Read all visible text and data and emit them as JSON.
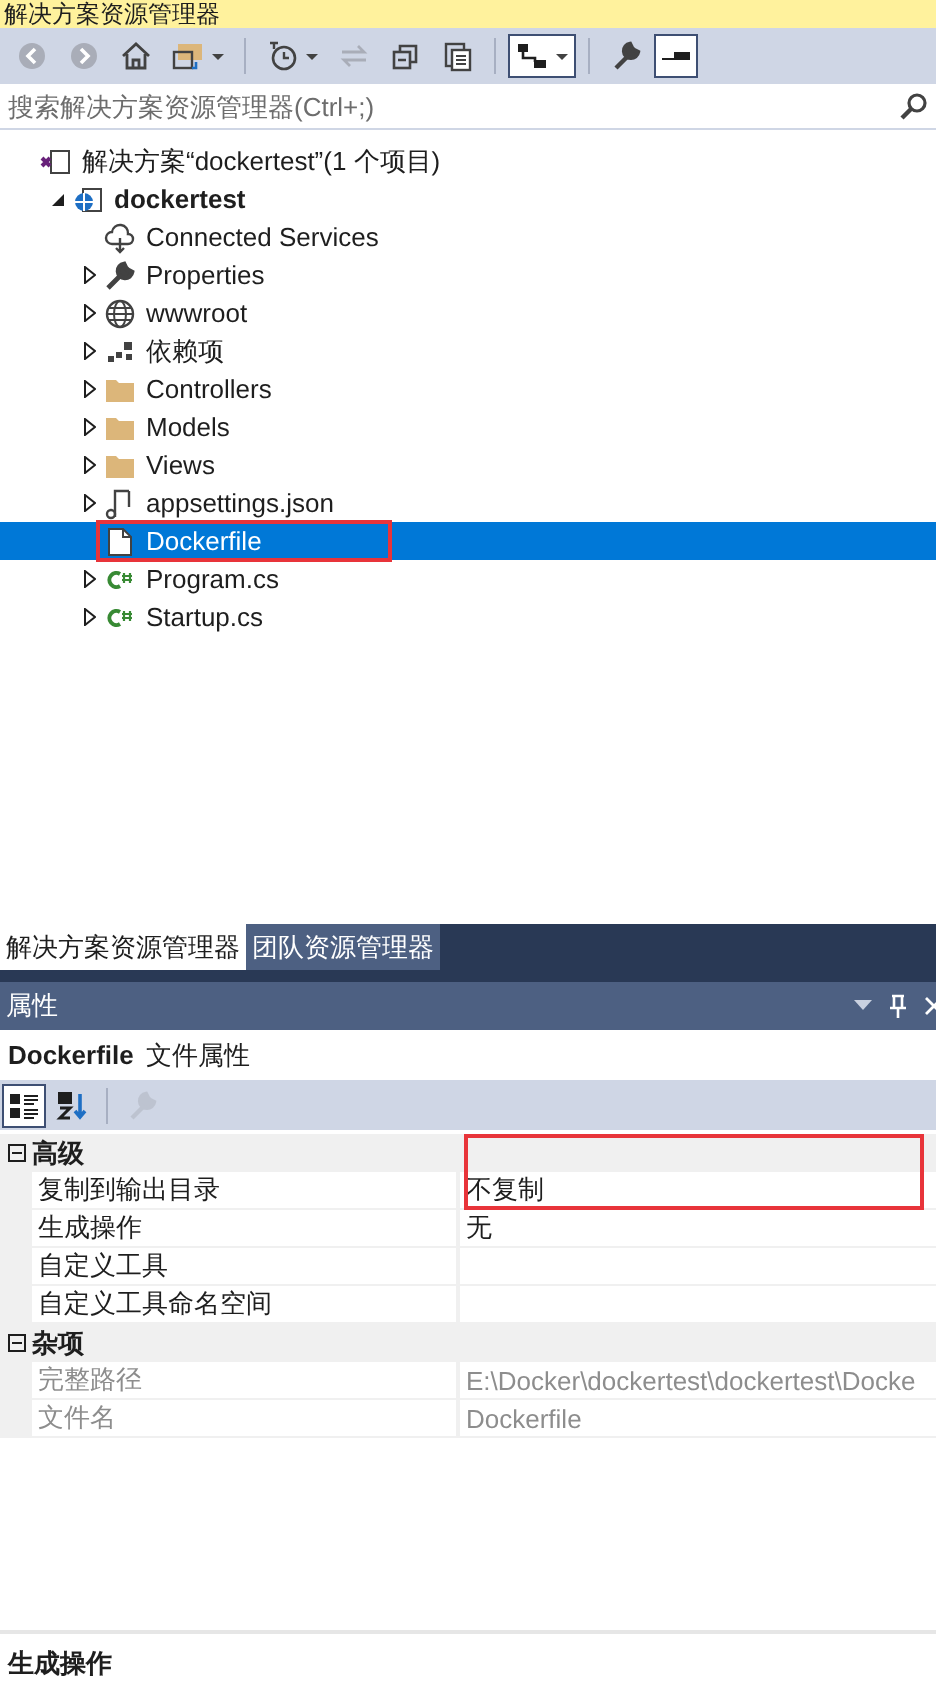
{
  "window": {
    "title": "解决方案资源管理器"
  },
  "toolbar": [
    {
      "kind": "back",
      "disabled": true,
      "checked": false,
      "dropdown": false
    },
    {
      "kind": "forward",
      "disabled": true,
      "checked": false,
      "dropdown": false
    },
    {
      "kind": "home",
      "disabled": false,
      "checked": false,
      "dropdown": false
    },
    {
      "kind": "switch-views",
      "disabled": false,
      "checked": false,
      "dropdown": true
    },
    {
      "kind": "separator"
    },
    {
      "kind": "history",
      "disabled": false,
      "checked": false,
      "dropdown": true
    },
    {
      "kind": "sync",
      "disabled": true,
      "checked": false,
      "dropdown": false
    },
    {
      "kind": "collapse",
      "disabled": false,
      "checked": false,
      "dropdown": false
    },
    {
      "kind": "copy",
      "disabled": false,
      "checked": false,
      "dropdown": false
    },
    {
      "kind": "separator"
    },
    {
      "kind": "hierarchy",
      "disabled": false,
      "checked": true,
      "dropdown": true
    },
    {
      "kind": "separator"
    },
    {
      "kind": "wrench",
      "disabled": false,
      "checked": false,
      "dropdown": false
    },
    {
      "kind": "preview",
      "disabled": false,
      "checked": true,
      "dropdown": false
    }
  ],
  "search": {
    "placeholder": "搜索解决方案资源管理器(Ctrl+;)"
  },
  "tree": [
    {
      "label": "解决方案“dockertest”(1 个项目)",
      "kind": "solution",
      "bold": false,
      "expandable": false,
      "selected": false,
      "highlighted": false,
      "children": [
        {
          "label": "dockertest",
          "kind": "project",
          "bold": true,
          "expandable": true,
          "expanded": true,
          "selected": false,
          "highlighted": false,
          "children": [
            {
              "label": "Connected Services",
              "kind": "cloud",
              "bold": false,
              "expandable": false,
              "selected": false,
              "highlighted": false
            },
            {
              "label": "Properties",
              "kind": "wrench",
              "bold": false,
              "expandable": true,
              "expanded": false,
              "selected": false,
              "highlighted": false
            },
            {
              "label": "wwwroot",
              "kind": "globe",
              "bold": false,
              "expandable": true,
              "expanded": false,
              "selected": false,
              "highlighted": false
            },
            {
              "label": "依赖项",
              "kind": "dependencies",
              "bold": false,
              "expandable": true,
              "expanded": false,
              "selected": false,
              "highlighted": false
            },
            {
              "label": "Controllers",
              "kind": "folder",
              "bold": false,
              "expandable": true,
              "expanded": false,
              "selected": false,
              "highlighted": false
            },
            {
              "label": "Models",
              "kind": "folder",
              "bold": false,
              "expandable": true,
              "expanded": false,
              "selected": false,
              "highlighted": false
            },
            {
              "label": "Views",
              "kind": "folder",
              "bold": false,
              "expandable": true,
              "expanded": false,
              "selected": false,
              "highlighted": false
            },
            {
              "label": "appsettings.json",
              "kind": "json",
              "bold": false,
              "expandable": true,
              "expanded": false,
              "selected": false,
              "highlighted": false
            },
            {
              "label": "Dockerfile",
              "kind": "file",
              "bold": false,
              "expandable": false,
              "selected": true,
              "highlighted": true
            },
            {
              "label": "Program.cs",
              "kind": "csharp",
              "bold": false,
              "expandable": true,
              "expanded": false,
              "selected": false,
              "highlighted": false
            },
            {
              "label": "Startup.cs",
              "kind": "csharp",
              "bold": false,
              "expandable": true,
              "expanded": false,
              "selected": false,
              "highlighted": false
            }
          ]
        }
      ]
    }
  ],
  "tabs": [
    {
      "label": "解决方案资源管理器",
      "selected": true
    },
    {
      "label": "团队资源管理器",
      "selected": false
    }
  ],
  "properties": {
    "title": "属性",
    "object_name": "Dockerfile",
    "object_type": "文件属性",
    "toolbar": [
      {
        "kind": "categorized",
        "checked": true,
        "disabled": false
      },
      {
        "kind": "alphabetical",
        "checked": false,
        "disabled": false
      },
      {
        "kind": "separator"
      },
      {
        "kind": "property-pages",
        "checked": false,
        "disabled": true
      }
    ],
    "categories": [
      {
        "name": "高级",
        "expanded": true,
        "rows": [
          {
            "name": "复制到输出目录",
            "value": "不复制",
            "disabled": false,
            "highlighted": true
          },
          {
            "name": "生成操作",
            "value": "无",
            "disabled": false,
            "highlighted": false
          },
          {
            "name": "自定义工具",
            "disabled": false,
            "highlighted": false
          },
          {
            "name": "自定义工具命名空间",
            "disabled": false,
            "highlighted": false
          }
        ]
      },
      {
        "name": "杂项",
        "expanded": true,
        "rows": [
          {
            "name": "完整路径",
            "value": "E:\\Docker\\dockertest\\dockertest\\Docke",
            "disabled": true,
            "highlighted": false
          },
          {
            "name": "文件名",
            "value": "Dockerfile",
            "disabled": true,
            "highlighted": false
          }
        ]
      }
    ],
    "description": {
      "title": "生成操作"
    }
  }
}
